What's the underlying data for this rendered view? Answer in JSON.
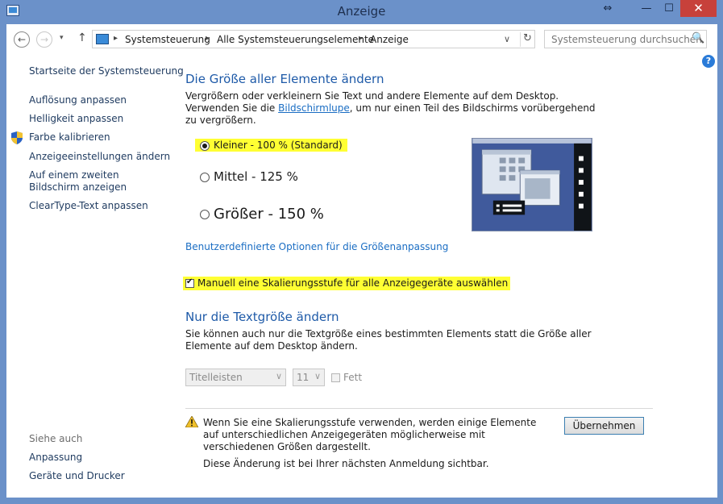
{
  "window": {
    "title": "Anzeige",
    "controls": {
      "restore": "⇔",
      "minimize": "—",
      "maximize": "☐",
      "close": "✕"
    }
  },
  "nav": {
    "back": "←",
    "forward": "→",
    "recent": "▾",
    "up": "↑"
  },
  "address": {
    "crumbs": [
      "Systemsteuerung",
      "Alle Systemsteuerungselemente",
      "Anzeige"
    ],
    "separator": "▸",
    "dropdown": "∨",
    "refresh": "↻"
  },
  "search": {
    "placeholder": "Systemsteuerung durchsuchen",
    "icon": "🔍"
  },
  "help": {
    "label": "?"
  },
  "sidebar": {
    "home": "Startseite der Systemsteuerung",
    "items": [
      "Auflösung anpassen",
      "Helligkeit anpassen",
      "Farbe kalibrieren",
      "Anzeigeeinstellungen ändern",
      "Auf einem zweiten Bildschirm anzeigen",
      "ClearType-Text anpassen"
    ],
    "see_also_heading": "Siehe auch",
    "see_also": [
      "Anpassung",
      "Geräte und Drucker"
    ]
  },
  "main": {
    "heading": "Die Größe aller Elemente ändern",
    "description_before": "Vergrößern oder verkleinern Sie Text und andere Elemente auf dem Desktop. Verwenden Sie die ",
    "description_link": "Bildschirmlupe",
    "description_after": ", um nur einen Teil des Bildschirms vorübergehend zu vergrößern.",
    "options": [
      {
        "label": "Kleiner - 100 % (Standard)",
        "checked": true
      },
      {
        "label": "Mittel - 125 %",
        "checked": false
      },
      {
        "label": "Größer - 150 %",
        "checked": false
      }
    ],
    "custom_link": "Benutzerdefinierte Optionen für die Größenanpassung",
    "manual_scaling": {
      "label": "Manuell eine Skalierungsstufe für alle Anzeigegeräte auswählen",
      "checked": true
    },
    "text_heading": "Nur die Textgröße ändern",
    "text_description": "Sie können auch nur die Textgröße eines bestimmten Elements statt die Größe aller Elemente auf dem Desktop ändern.",
    "element_select": "Titelleisten",
    "size_select": "11",
    "bold_label": "Fett",
    "warning": "Wenn Sie eine Skalierungsstufe verwenden, werden einige Elemente auf unterschiedlichen Anzeigegeräten möglicherweise mit verschiedenen Größen dargestellt.",
    "notice": "Diese Änderung ist bei Ihrer nächsten Anmeldung sichtbar.",
    "apply_button": "Übernehmen"
  },
  "colors": {
    "heading": "#1e5aa8",
    "link": "#1a6dc3",
    "highlight": "#ffff33",
    "titlebar": "#6b91c9",
    "close": "#c7413b"
  }
}
